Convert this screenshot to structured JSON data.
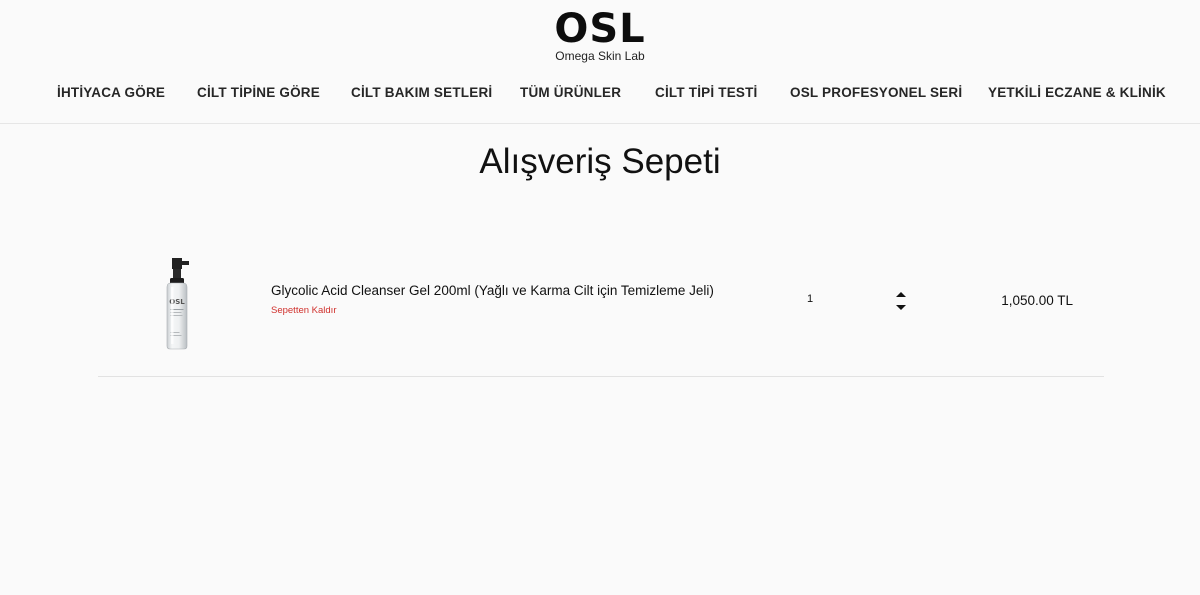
{
  "brand": {
    "logo_text": "OSL",
    "tagline": "Omega Skin Lab"
  },
  "nav": {
    "items": [
      {
        "label": "İHTİYACA GÖRE"
      },
      {
        "label": "CİLT TİPİNE GÖRE"
      },
      {
        "label": "CİLT BAKIM SETLERİ"
      },
      {
        "label": "TÜM ÜRÜNLER"
      },
      {
        "label": "CİLT TİPİ TESTİ"
      },
      {
        "label": "OSL PROFESYONEL SERİ"
      },
      {
        "label": "YETKİLİ ECZANE & KLİNİK"
      }
    ]
  },
  "page": {
    "title": "Alışveriş Sepeti"
  },
  "cart": {
    "items": [
      {
        "name": "Glycolic Acid Cleanser Gel 200ml (Yağlı ve Karma Cilt için Temizleme Jeli)",
        "remove_label": "Sepetten Kaldır",
        "quantity": "1",
        "price": "1,050.00 TL",
        "image_label": "OSL"
      }
    ]
  },
  "colors": {
    "background": "#fafafa",
    "remove_link": "#d0312d",
    "text": "#111111"
  }
}
